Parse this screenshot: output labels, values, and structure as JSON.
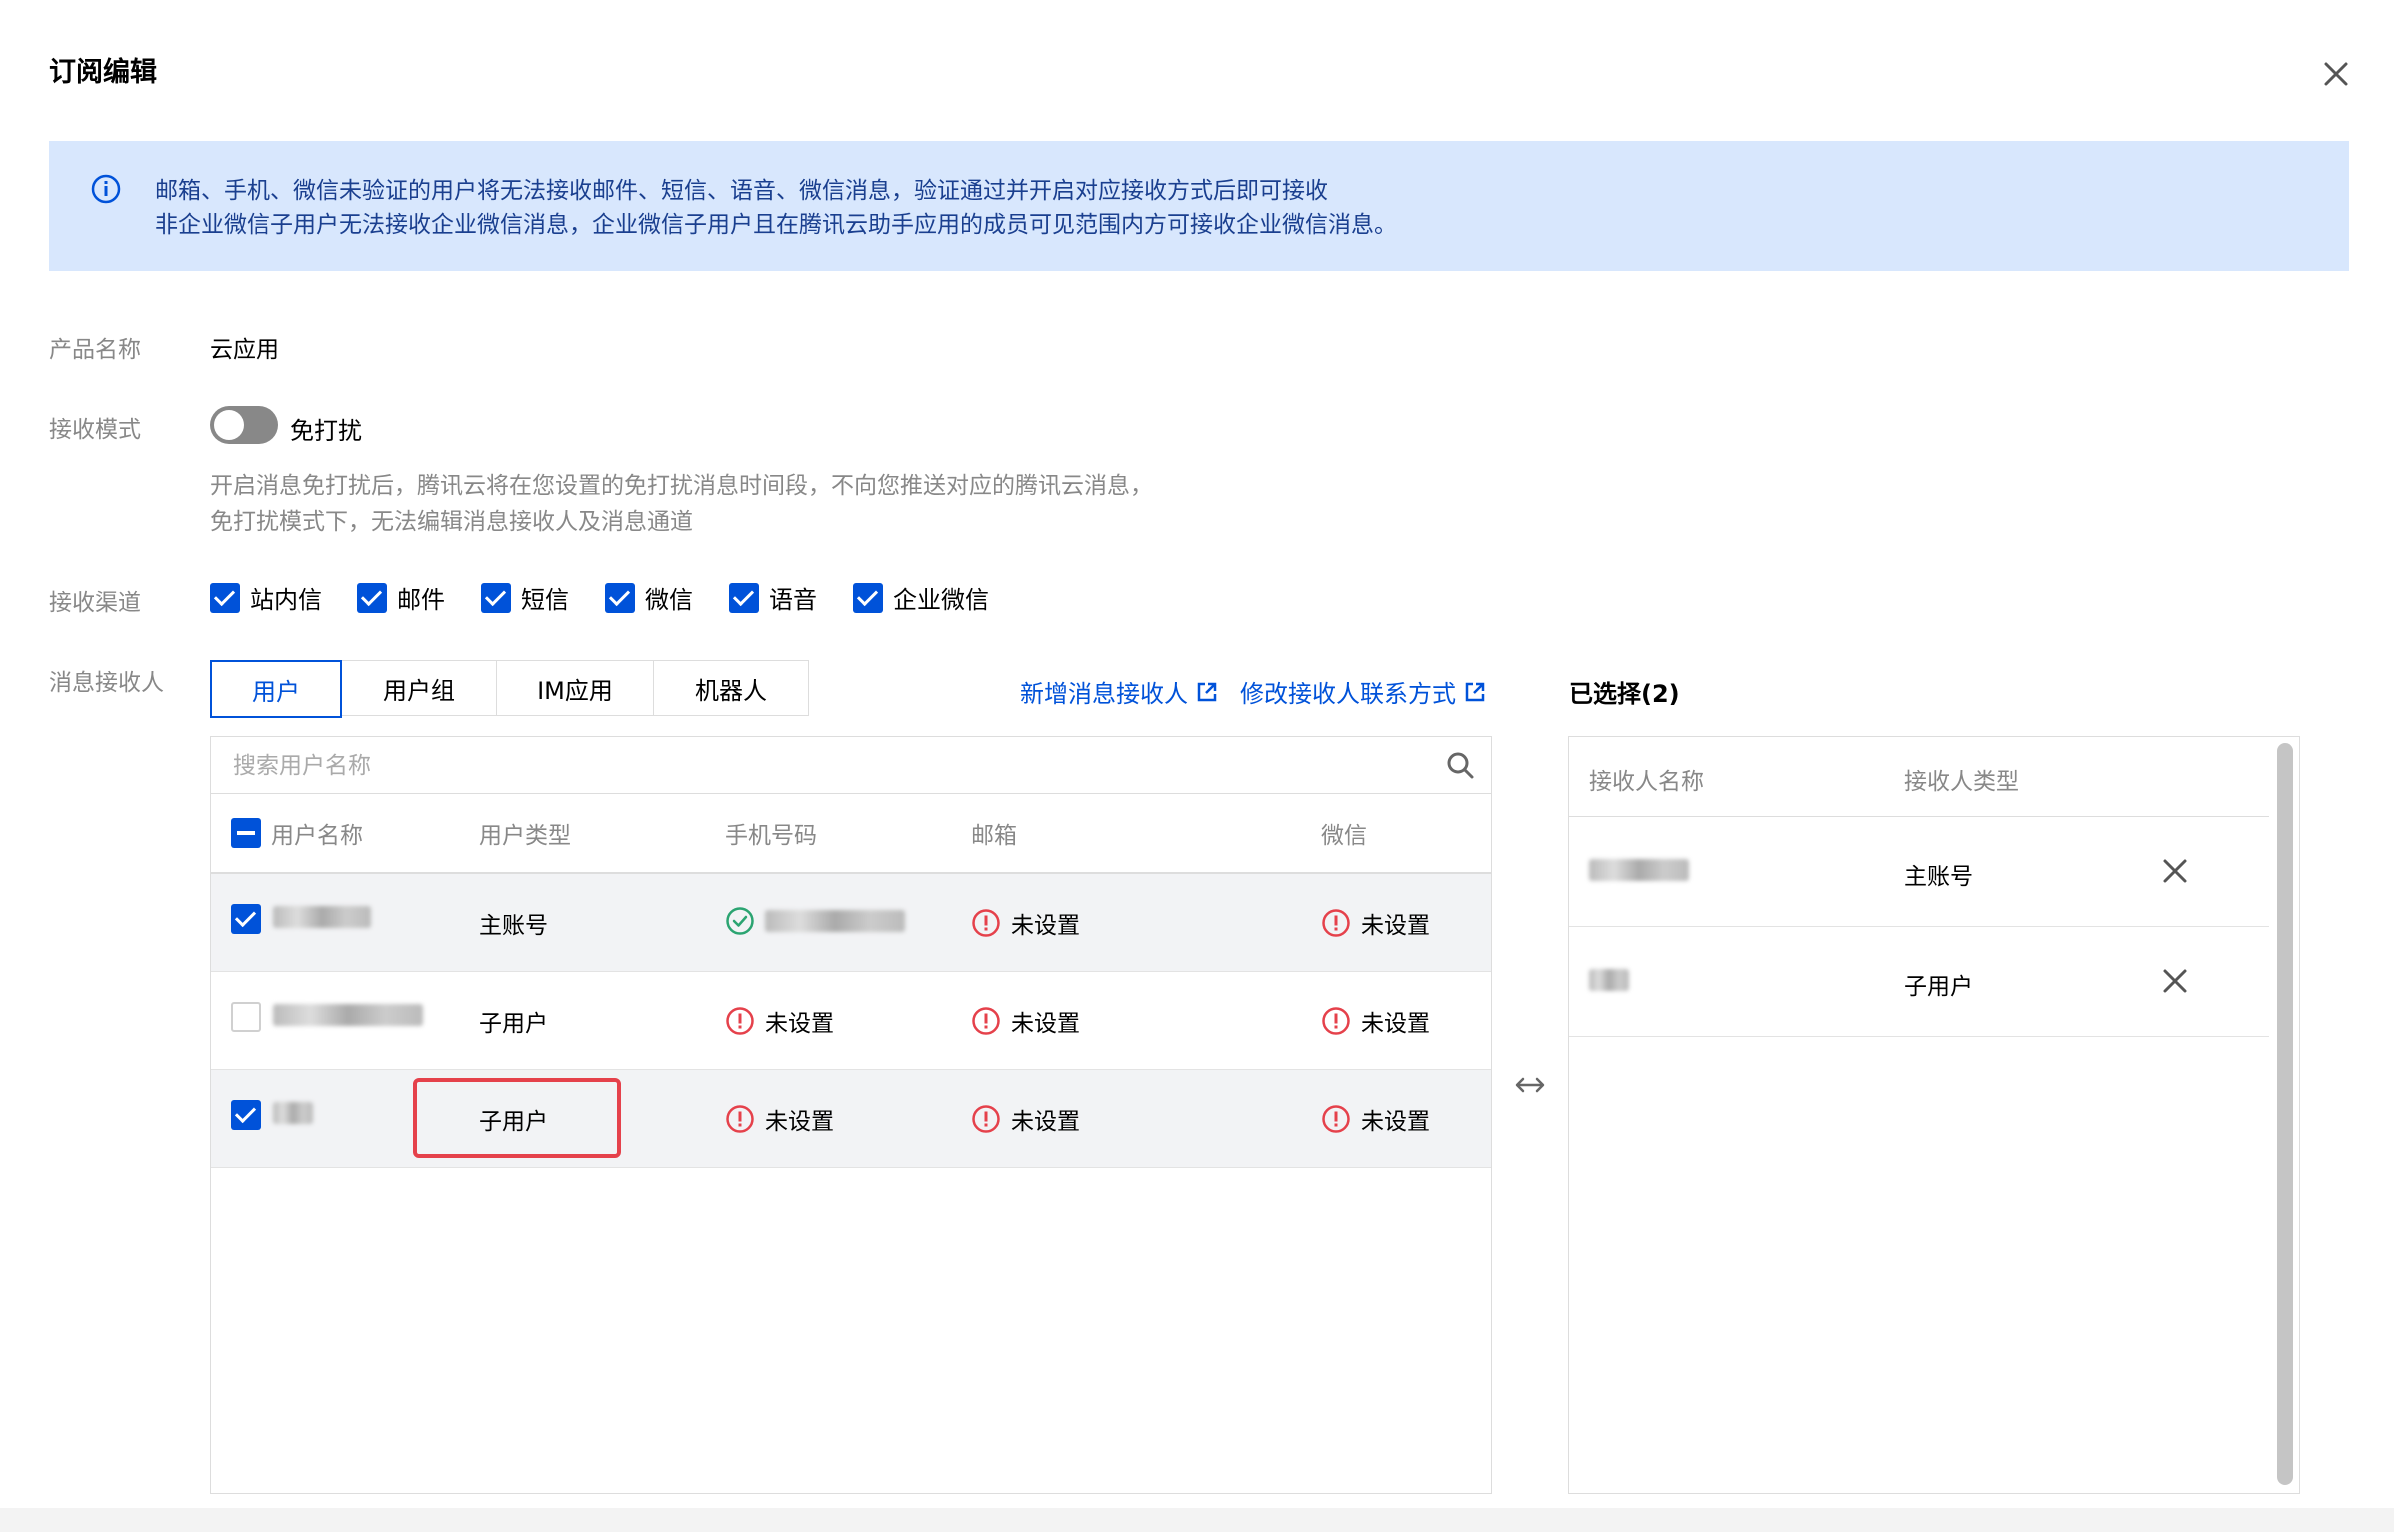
{
  "dialog": {
    "title": "订阅编辑"
  },
  "notice": {
    "line1": "邮箱、手机、微信未验证的用户将无法接收邮件、短信、语音、微信消息，验证通过并开启对应接收方式后即可接收",
    "line2": "非企业微信子用户无法接收企业微信消息，企业微信子用户且在腾讯云助手应用的成员可见范围内方可接收企业微信消息。"
  },
  "form": {
    "product_label": "产品名称",
    "product_value": "云应用",
    "mode_label": "接收模式",
    "dnd_label": "免打扰",
    "dnd_desc_1": "开启消息免打扰后，腾讯云将在您设置的免打扰消息时间段，不向您推送对应的腾讯云消息，",
    "dnd_desc_2": "免打扰模式下，无法编辑消息接收人及消息通道",
    "channel_label": "接收渠道",
    "channels": [
      {
        "label": "站内信",
        "checked": true
      },
      {
        "label": "邮件",
        "checked": true
      },
      {
        "label": "短信",
        "checked": true
      },
      {
        "label": "微信",
        "checked": true
      },
      {
        "label": "语音",
        "checked": true
      },
      {
        "label": "企业微信",
        "checked": true
      }
    ],
    "recipient_label": "消息接收人"
  },
  "tabs": [
    {
      "label": "用户",
      "active": true
    },
    {
      "label": "用户组",
      "active": false
    },
    {
      "label": "IM应用",
      "active": false
    },
    {
      "label": "机器人",
      "active": false
    }
  ],
  "links": {
    "add_recipient": "新增消息接收人",
    "edit_contact": "修改接收人联系方式"
  },
  "search": {
    "placeholder": "搜索用户名称"
  },
  "table": {
    "columns": [
      "用户名称",
      "用户类型",
      "手机号码",
      "邮箱",
      "微信"
    ],
    "rows": [
      {
        "type": "主账号",
        "phone": "",
        "email": "未设置",
        "wechat": "未设置",
        "checked": true
      },
      {
        "type": "子用户",
        "phone": "未设置",
        "email": "未设置",
        "wechat": "未设置",
        "checked": false
      },
      {
        "type": "子用户",
        "phone": "未设置",
        "email": "未设置",
        "wechat": "未设置",
        "checked": true
      }
    ]
  },
  "selected": {
    "title": "已选择(2)",
    "columns": [
      "接收人名称",
      "接收人类型"
    ],
    "rows": [
      {
        "type": "主账号"
      },
      {
        "type": "子用户"
      }
    ]
  },
  "colors": {
    "primary": "#0052d9",
    "error": "#e5414b",
    "success": "#2ba471",
    "notice_bg": "#d8e7fd"
  }
}
